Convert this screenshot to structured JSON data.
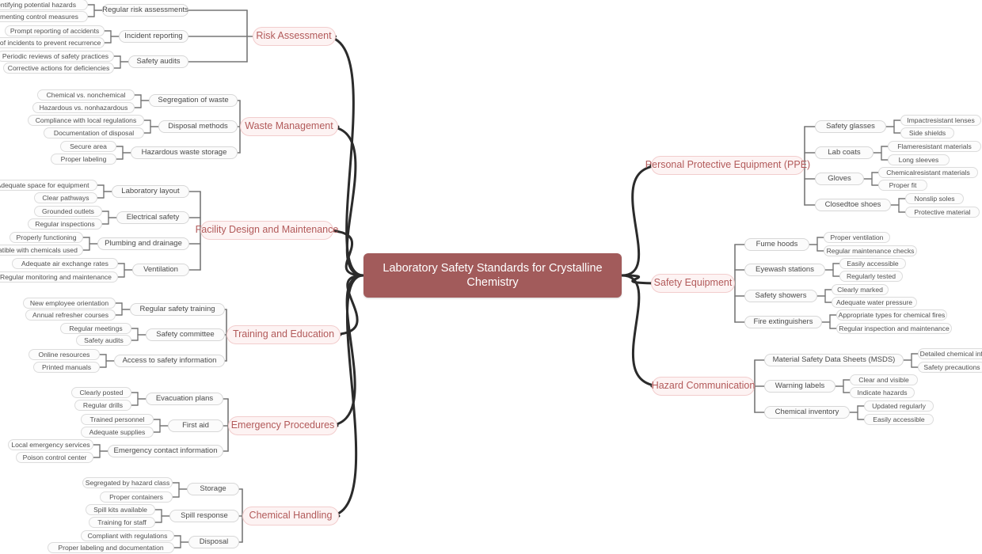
{
  "title": "Laboratory Safety Standards for Crystalline Chemistry",
  "colors": {
    "root_fill": "#a25b5b",
    "root_text": "#ffffff",
    "branch_fill": "#fdf3f3",
    "branch_border": "#f2cdcd",
    "branch_text": "#b25a5a",
    "node_fill": "#fbfbfb",
    "node_border": "#d7d7d7",
    "node_text": "#4a4a4a",
    "edge_main": "#2b2b2b",
    "edge_sub": "#777777",
    "background": "#ffffff"
  },
  "root": {
    "label": "Laboratory Safety Standards for Crystalline Chemistry"
  },
  "branches": [
    {
      "label": "Risk Assessment",
      "side": "left",
      "children": [
        {
          "label": "Regular risk assessments",
          "leaves": [
            "Identifying potential hazards",
            "Implementing control measures"
          ]
        },
        {
          "label": "Incident reporting",
          "leaves": [
            "Prompt reporting of accidents",
            "Analysis of incidents to prevent recurrence"
          ]
        },
        {
          "label": "Safety audits",
          "leaves": [
            "Periodic reviews of safety practices",
            "Corrective actions for deficiencies"
          ]
        }
      ]
    },
    {
      "label": "Waste Management",
      "side": "left",
      "children": [
        {
          "label": "Segregation of waste",
          "leaves": [
            "Chemical vs. nonchemical",
            "Hazardous vs. nonhazardous"
          ]
        },
        {
          "label": "Disposal methods",
          "leaves": [
            "Compliance with local regulations",
            "Documentation of disposal"
          ]
        },
        {
          "label": "Hazardous waste storage",
          "leaves": [
            "Secure area",
            "Proper labeling"
          ]
        }
      ]
    },
    {
      "label": "Facility Design and Maintenance",
      "side": "left",
      "children": [
        {
          "label": "Laboratory layout",
          "leaves": [
            "Adequate space for equipment",
            "Clear pathways"
          ]
        },
        {
          "label": "Electrical safety",
          "leaves": [
            "Grounded outlets",
            "Regular inspections"
          ]
        },
        {
          "label": "Plumbing and drainage",
          "leaves": [
            "Properly functioning",
            "Compatible with chemicals used"
          ]
        },
        {
          "label": "Ventilation",
          "leaves": [
            "Adequate air exchange rates",
            "Regular monitoring and maintenance"
          ]
        }
      ]
    },
    {
      "label": "Training and Education",
      "side": "left",
      "children": [
        {
          "label": "Regular safety training",
          "leaves": [
            "New employee orientation",
            "Annual refresher courses"
          ]
        },
        {
          "label": "Safety committee",
          "leaves": [
            "Regular meetings",
            "Safety audits"
          ]
        },
        {
          "label": "Access to safety information",
          "leaves": [
            "Online resources",
            "Printed manuals"
          ]
        }
      ]
    },
    {
      "label": "Emergency Procedures",
      "side": "left",
      "children": [
        {
          "label": "Evacuation plans",
          "leaves": [
            "Clearly posted",
            "Regular drills"
          ]
        },
        {
          "label": "First aid",
          "leaves": [
            "Trained personnel",
            "Adequate supplies"
          ]
        },
        {
          "label": "Emergency contact information",
          "leaves": [
            "Local emergency services",
            "Poison control center"
          ]
        }
      ]
    },
    {
      "label": "Chemical Handling",
      "side": "left",
      "children": [
        {
          "label": "Storage",
          "leaves": [
            "Segregated by hazard class",
            "Proper containers"
          ]
        },
        {
          "label": "Spill response",
          "leaves": [
            "Spill kits available",
            "Training for staff"
          ]
        },
        {
          "label": "Disposal",
          "leaves": [
            "Compliant with regulations",
            "Proper labeling and documentation"
          ]
        }
      ]
    },
    {
      "label": "Personal Protective Equipment (PPE)",
      "side": "right",
      "children": [
        {
          "label": "Safety glasses",
          "leaves": [
            "Impactresistant lenses",
            "Side shields"
          ]
        },
        {
          "label": "Lab coats",
          "leaves": [
            "Flameresistant materials",
            "Long sleeves"
          ]
        },
        {
          "label": "Gloves",
          "leaves": [
            "Chemicalresistant materials",
            "Proper fit"
          ]
        },
        {
          "label": "Closedtoe shoes",
          "leaves": [
            "Nonslip soles",
            "Protective material"
          ]
        }
      ]
    },
    {
      "label": "Safety Equipment",
      "side": "right",
      "children": [
        {
          "label": "Fume hoods",
          "leaves": [
            "Proper ventilation",
            "Regular maintenance checks"
          ]
        },
        {
          "label": "Eyewash stations",
          "leaves": [
            "Easily accessible",
            "Regularly tested"
          ]
        },
        {
          "label": "Safety showers",
          "leaves": [
            "Clearly marked",
            "Adequate water pressure"
          ]
        },
        {
          "label": "Fire extinguishers",
          "leaves": [
            "Appropriate types for chemical fires",
            "Regular inspection and maintenance"
          ]
        }
      ]
    },
    {
      "label": "Hazard Communication",
      "side": "right",
      "children": [
        {
          "label": "Material Safety Data Sheets (MSDS)",
          "leaves": [
            "Detailed chemical information",
            "Safety precautions"
          ]
        },
        {
          "label": "Warning labels",
          "leaves": [
            "Clear and visible",
            "Indicate hazards"
          ]
        },
        {
          "label": "Chemical inventory",
          "leaves": [
            "Updated regularly",
            "Easily accessible"
          ]
        }
      ]
    }
  ]
}
